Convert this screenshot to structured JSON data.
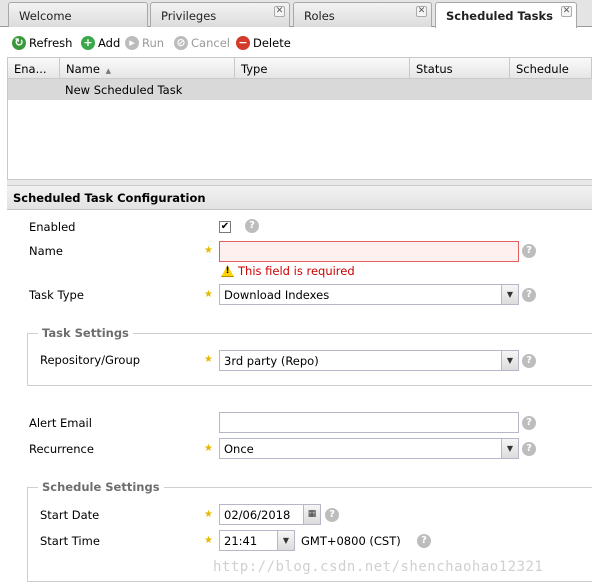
{
  "tabs": [
    {
      "label": "Welcome",
      "closable": false,
      "active": false
    },
    {
      "label": "Privileges",
      "closable": true,
      "active": false
    },
    {
      "label": "Roles",
      "closable": true,
      "active": false
    },
    {
      "label": "Scheduled Tasks",
      "closable": true,
      "active": true
    }
  ],
  "toolbar": {
    "refresh": "Refresh",
    "add": "Add",
    "run": "Run",
    "cancel": "Cancel",
    "delete": "Delete"
  },
  "grid": {
    "columns": [
      "Ena...",
      "Name",
      "Type",
      "Status",
      "Schedule"
    ],
    "sort_indicator": "▲",
    "rows": [
      {
        "name": "New Scheduled Task"
      }
    ]
  },
  "form": {
    "title": "Scheduled Task Configuration",
    "enabled_label": "Enabled",
    "enabled_checked": true,
    "name_label": "Name",
    "name_value": "",
    "name_error": "This field is required",
    "task_type_label": "Task Type",
    "task_type_value": "Download Indexes",
    "task_settings_legend": "Task Settings",
    "repository_label": "Repository/Group",
    "repository_value": "3rd party (Repo)",
    "alert_email_label": "Alert Email",
    "alert_email_value": "",
    "recurrence_label": "Recurrence",
    "recurrence_value": "Once",
    "schedule_settings_legend": "Schedule Settings",
    "start_date_label": "Start Date",
    "start_date_value": "02/06/2018",
    "start_time_label": "Start Time",
    "start_time_value": "21:41",
    "timezone": "GMT+0800 (CST)"
  },
  "icons": {
    "close": "✕",
    "help": "?",
    "required": "★",
    "combo": "▼",
    "check": "✔",
    "warning": "!"
  },
  "watermark": "http://blog.csdn.net/shenchaohao12321",
  "colors": {
    "refresh": "#3a9a3a",
    "add": "#3aa84a",
    "delete": "#d33a2a",
    "disabled": "#9a9a9a",
    "error": "#cc0000",
    "required": "#e6b800"
  }
}
